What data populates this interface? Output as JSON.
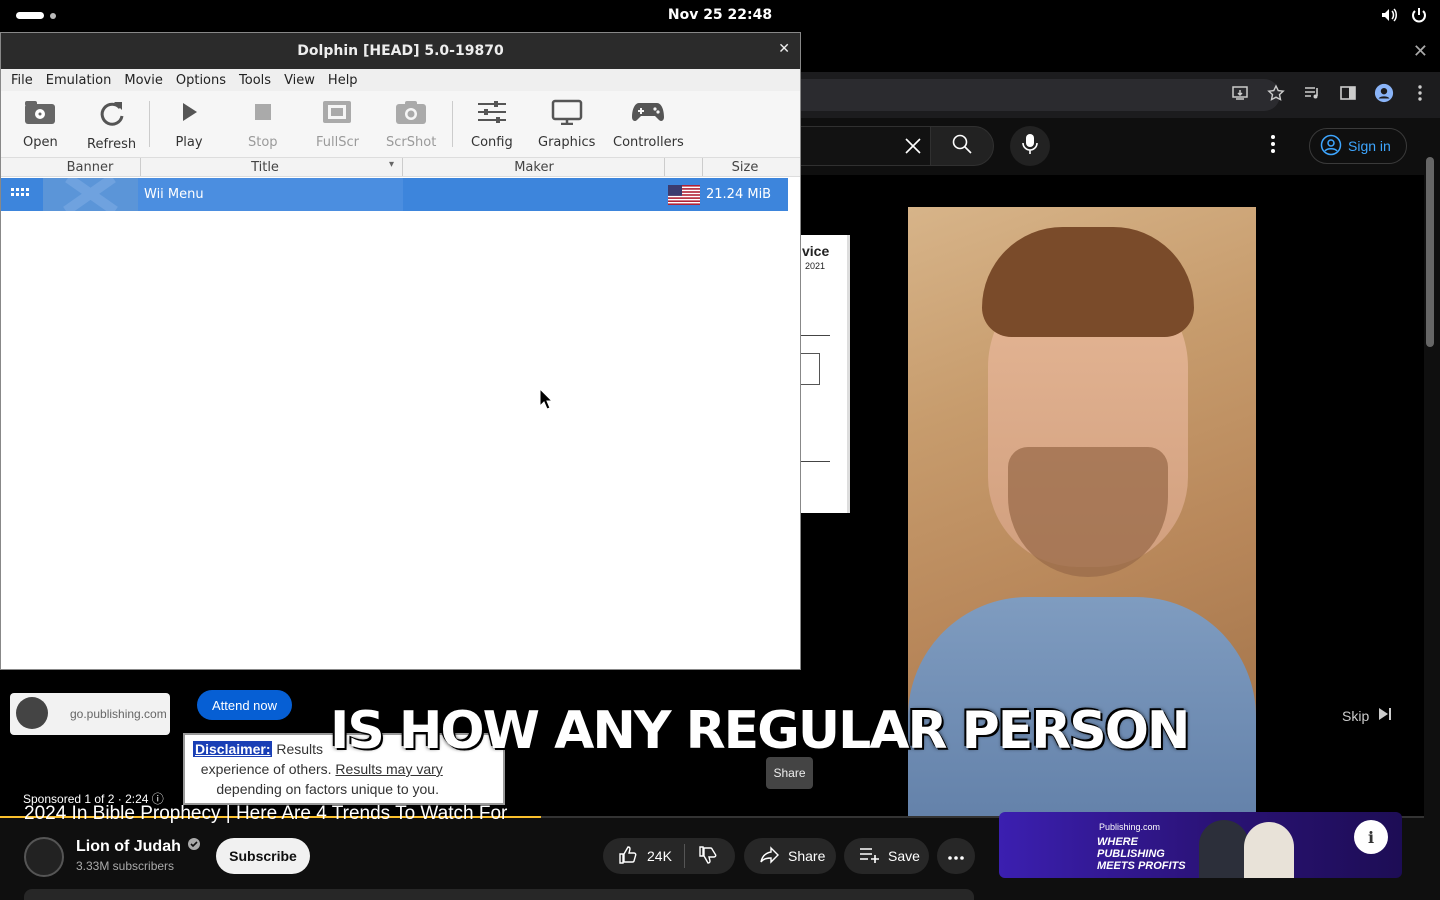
{
  "topbar": {
    "clock": "Nov 25  22:48"
  },
  "youtube": {
    "sign_in": "Sign in",
    "video_title": "2024 In Bible Prophecy | Here Are 4 Trends To Watch For",
    "channel_name": "Lion of Judah",
    "subscribers": "3.33M subscribers",
    "subscribe_label": "Subscribe",
    "likes": "24K",
    "share_label": "Share",
    "save_label": "Save",
    "share_tooltip": "Share",
    "progress": 0.38,
    "ad": {
      "url": "go.publishing.com",
      "attend_label": "Attend now",
      "disclaimer_tag": "Disclaimer:",
      "disclaimer_text_1": " Results",
      "disclaimer_text_2": "experience of others. ",
      "disclaimer_link": "Results may vary",
      "disclaimer_text_3": "depending on factors unique to you.",
      "sponsored": "Sponsored 1 of 2 · 2:24",
      "skip_label": "Skip",
      "caption": "IS HOW ANY REGULAR PERSON",
      "doc_heading": "vice",
      "doc_sub": "2021",
      "promo_brand": "Publishing.com",
      "promo_tagline": "WHERE PUBLISHING MEETS PROFITS"
    }
  },
  "dolphin": {
    "title": "Dolphin [HEAD] 5.0-19870",
    "menu": [
      "File",
      "Emulation",
      "Movie",
      "Options",
      "Tools",
      "View",
      "Help"
    ],
    "toolbar": {
      "open": "Open",
      "refresh": "Refresh",
      "play": "Play",
      "stop": "Stop",
      "fullscr": "FullScr",
      "scrshot": "ScrShot",
      "config": "Config",
      "graphics": "Graphics",
      "controllers": "Controllers"
    },
    "columns": {
      "banner": "Banner",
      "title": "Title",
      "maker": "Maker",
      "size": "Size"
    },
    "games": [
      {
        "title": "Wii Menu",
        "maker": "",
        "size": "21.24 MiB",
        "region_icon": "us-flag-icon"
      }
    ]
  },
  "colors": {
    "selection": "#3d85dc",
    "yt_link": "#3ea6ff",
    "progress": "#fbc02d"
  }
}
